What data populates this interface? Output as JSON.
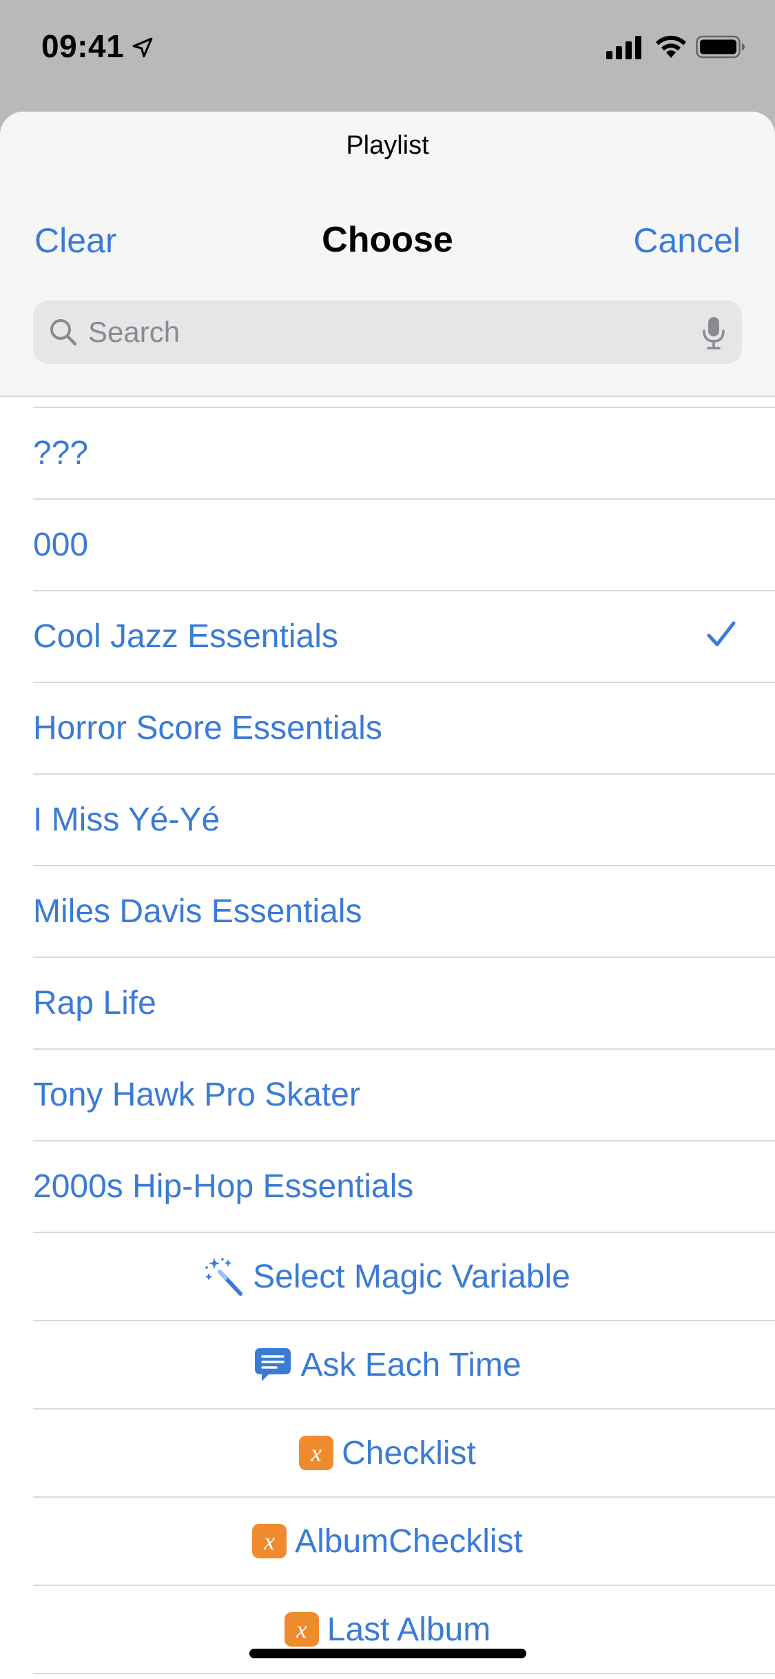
{
  "status_bar": {
    "time": "09:41"
  },
  "sheet": {
    "prompt": "Playlist",
    "nav": {
      "clear_label": "Clear",
      "title": "Choose",
      "cancel_label": "Cancel"
    },
    "search": {
      "placeholder": "Search",
      "value": ""
    }
  },
  "playlists": [
    {
      "label": "???",
      "selected": false
    },
    {
      "label": "000",
      "selected": false
    },
    {
      "label": "Cool Jazz Essentials",
      "selected": true
    },
    {
      "label": "Horror Score Essentials",
      "selected": false
    },
    {
      "label": "I Miss Yé-Yé",
      "selected": false
    },
    {
      "label": "Miles Davis Essentials",
      "selected": false
    },
    {
      "label": "Rap Life",
      "selected": false
    },
    {
      "label": "Tony Hawk Pro Skater",
      "selected": false
    },
    {
      "label": "2000s Hip-Hop Essentials",
      "selected": false
    }
  ],
  "actions": [
    {
      "label": "Select Magic Variable",
      "icon": "magic-wand-icon"
    },
    {
      "label": "Ask Each Time",
      "icon": "speech-bubble-icon"
    },
    {
      "label": "Checklist",
      "icon": "variable-icon"
    },
    {
      "label": "AlbumChecklist",
      "icon": "variable-icon"
    },
    {
      "label": "Last Album",
      "icon": "variable-icon"
    }
  ],
  "variable_icon_glyph": "x",
  "colors": {
    "accent": "#3a7bd5",
    "variable_badge": "#ef8b2c"
  }
}
